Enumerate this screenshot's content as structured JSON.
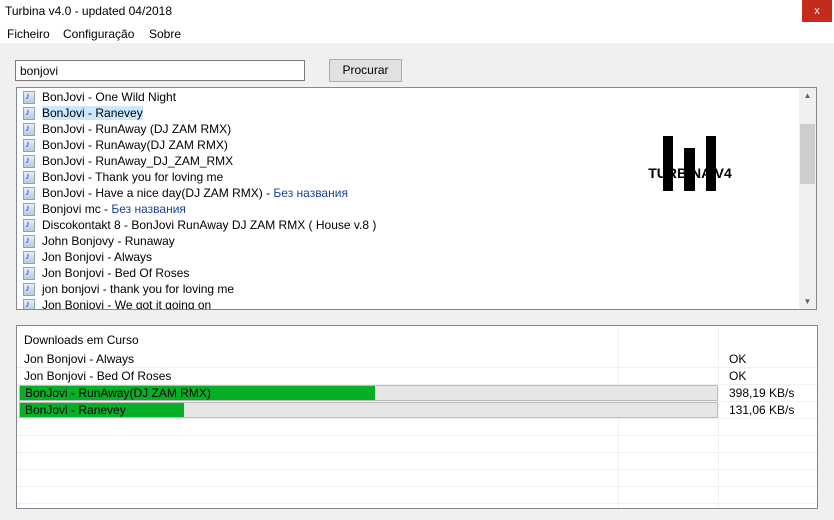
{
  "window": {
    "title": "Turbina v4.0 - updated 04/2018",
    "close_label": "x"
  },
  "menu": [
    "Ficheiro",
    "Configuração",
    "Sobre"
  ],
  "search": {
    "value": "bonjovi",
    "button": "Procurar"
  },
  "results": [
    {
      "title": "BonJovi - One Wild Night",
      "suffix": ""
    },
    {
      "title": "BonJovi - Ranevey",
      "suffix": "",
      "selected": true
    },
    {
      "title": "BonJovi - RunAway (DJ ZAM RMX)",
      "suffix": ""
    },
    {
      "title": "BonJovi - RunAway(DJ ZAM RMX)",
      "suffix": ""
    },
    {
      "title": "BonJovi - RunAway_DJ_ZAM_RMX",
      "suffix": ""
    },
    {
      "title": "BonJovi - Thank you for loving me",
      "suffix": ""
    },
    {
      "title": "BonJovi - Have a nice day(DJ ZAM RMX) - ",
      "suffix": "Без названия"
    },
    {
      "title": "Bonjovi mc - ",
      "suffix": "Без названия"
    },
    {
      "title": "Discokontakt 8 - BonJovi RunAway DJ ZAM RMX ( House v.8 )",
      "suffix": ""
    },
    {
      "title": "John Bonjovy - Runaway",
      "suffix": ""
    },
    {
      "title": "Jon Bonjovi - Always",
      "suffix": ""
    },
    {
      "title": "Jon Bonjovi - Bed Of Roses",
      "suffix": ""
    },
    {
      "title": "jon bonjovi - thank you for loving me",
      "suffix": ""
    },
    {
      "title": "Jon Bonjovi - We got it going on",
      "suffix": ""
    }
  ],
  "logo": {
    "text": "TURBINA V4"
  },
  "downloads": {
    "header": "Downloads em Curso",
    "rows": [
      {
        "name": "Jon Bonjovi - Always",
        "status": "OK"
      },
      {
        "name": "Jon Bonjovi - Bed Of Roses",
        "status": "OK"
      },
      {
        "name": "BonJovi - RunAway(DJ ZAM RMX)",
        "status": "398,19 KB/s",
        "progress": 51
      },
      {
        "name": "BonJovi - Ranevey",
        "status": "131,06 KB/s",
        "progress": 23.5
      }
    ]
  },
  "colors": {
    "progress": "#06b025",
    "selection": "#cce8ff"
  }
}
